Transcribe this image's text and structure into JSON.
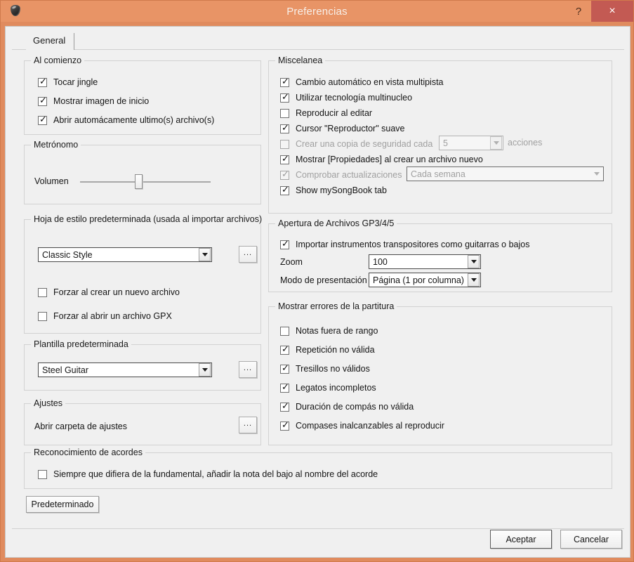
{
  "window": {
    "title": "Preferencias",
    "app_icon": "guitar-pick-icon",
    "help_label": "?",
    "close_label": "×",
    "titlebar_color": "#e89466",
    "close_button_color": "#c35a53",
    "client_background": "#f0f0f0"
  },
  "tabs": [
    {
      "label": "General",
      "selected": true
    }
  ],
  "groups": {
    "al_comienzo": {
      "legend": "Al comienzo",
      "items": [
        {
          "label": "Tocar jingle",
          "checked": true,
          "enabled": true
        },
        {
          "label": "Mostrar imagen de inicio",
          "checked": true,
          "enabled": true
        },
        {
          "label": "Abrir automácamente ultimo(s) archivo(s)",
          "checked": true,
          "enabled": true
        }
      ]
    },
    "metronomo": {
      "legend": "Metrónomo",
      "volume_label": "Volumen",
      "volume_percent": 55
    },
    "hoja_estilo": {
      "legend": "Hoja de estilo predeterminada (usada al importar archivos)",
      "style_value": "Classic Style",
      "browse_label": "...",
      "items": [
        {
          "label": "Forzar al crear un nuevo archivo",
          "checked": false,
          "enabled": true
        },
        {
          "label": "Forzar al abrir un archivo GPX",
          "checked": false,
          "enabled": true
        }
      ]
    },
    "plantilla": {
      "legend": "Plantilla predeterminada",
      "template_value": "Steel Guitar",
      "browse_label": "..."
    },
    "ajustes": {
      "legend": "Ajustes",
      "open_folder_label": "Abrir carpeta de ajustes",
      "browse_label": "..."
    },
    "miscelanea": {
      "legend": "Miscelanea",
      "items": [
        {
          "label": "Cambio automático en vista multipista",
          "checked": true,
          "enabled": true
        },
        {
          "label": "Utilizar tecnología multinucleo",
          "checked": true,
          "enabled": true
        },
        {
          "label": "Reproducir al editar",
          "checked": false,
          "enabled": true
        },
        {
          "label": "Cursor \"Reproductor\" suave",
          "checked": true,
          "enabled": true
        },
        {
          "label": "Crear una copia de seguridad cada",
          "checked": false,
          "enabled": false
        },
        {
          "label": "Mostrar [Propiedades] al crear un archivo nuevo",
          "checked": true,
          "enabled": true
        },
        {
          "label": "Comprobar actualizaciones",
          "checked": true,
          "enabled": false
        },
        {
          "label": "Show mySongBook tab",
          "checked": true,
          "enabled": true
        }
      ],
      "backup_count_value": "5",
      "backup_suffix_label": "acciones",
      "update_frequency_value": "Cada semana"
    },
    "apertura": {
      "legend": "Apertura de Archivos GP3/4/5",
      "import_label": "Importar instrumentos transpositores como guitarras o bajos",
      "import_checked": true,
      "zoom_label": "Zoom",
      "zoom_value": "100",
      "presentation_label": "Modo de presentación",
      "presentation_value": "Página (1 por columna)"
    },
    "errores": {
      "legend": "Mostrar errores de la partitura",
      "items": [
        {
          "label": "Notas fuera de rango",
          "checked": false,
          "enabled": true
        },
        {
          "label": "Repetición no válida",
          "checked": true,
          "enabled": true
        },
        {
          "label": "Tresillos no válidos",
          "checked": true,
          "enabled": true
        },
        {
          "label": "Legatos incompletos",
          "checked": true,
          "enabled": true
        },
        {
          "label": "Duración de compás no válida",
          "checked": true,
          "enabled": true
        },
        {
          "label": "Compases inalcanzables al reproducir",
          "checked": true,
          "enabled": true
        }
      ]
    },
    "acordes": {
      "legend": "Reconocimiento de acordes",
      "items": [
        {
          "label": "Siempre que difiera de la fundamental, añadir la nota del bajo al nombre del acorde",
          "checked": false,
          "enabled": true
        }
      ]
    }
  },
  "buttons": {
    "default_label": "Predeterminado",
    "ok_label": "Aceptar",
    "cancel_label": "Cancelar"
  }
}
